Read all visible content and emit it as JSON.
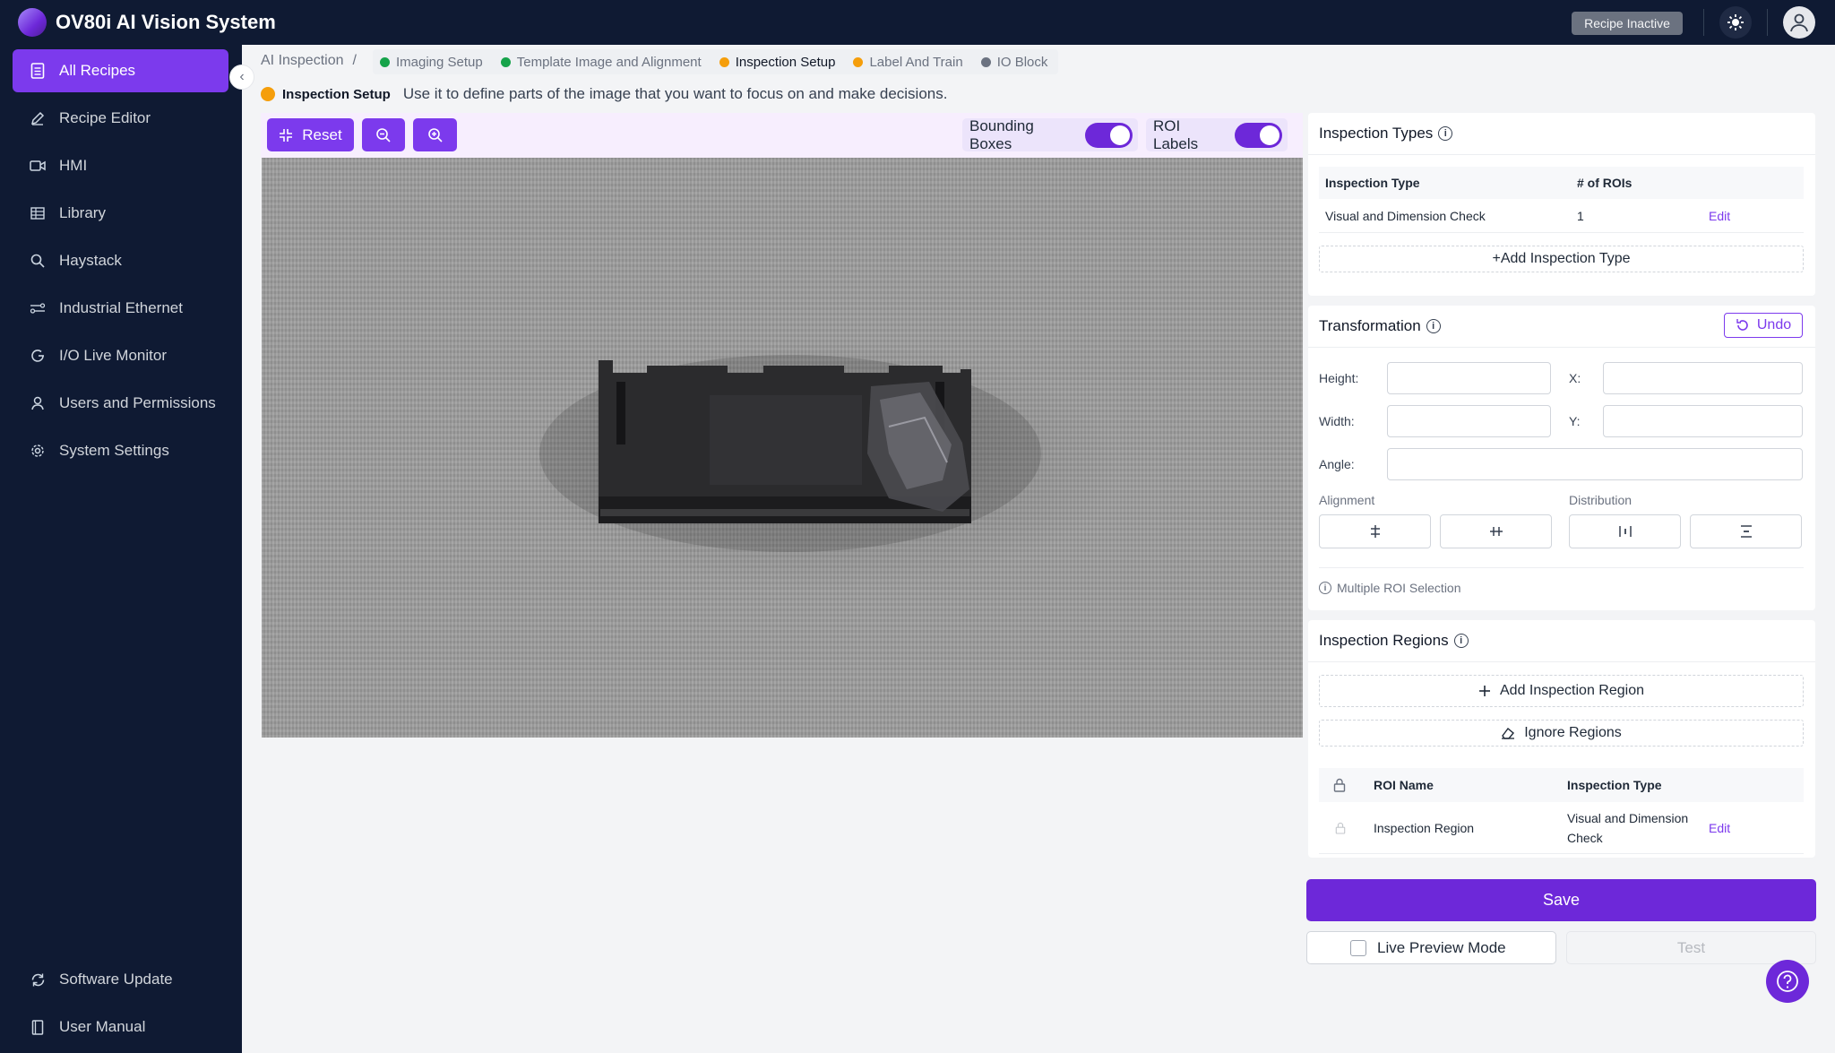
{
  "app": {
    "title": "OV80i AI Vision System",
    "recipe_status": "Recipe Inactive"
  },
  "sidebar": {
    "items": [
      {
        "label": "All Recipes",
        "icon": "document-icon",
        "active": true
      },
      {
        "label": "Recipe Editor",
        "icon": "pencil-icon"
      },
      {
        "label": "HMI",
        "icon": "video-icon"
      },
      {
        "label": "Library",
        "icon": "grid-icon"
      },
      {
        "label": "Haystack",
        "icon": "search-icon"
      },
      {
        "label": "Industrial Ethernet",
        "icon": "network-icon"
      },
      {
        "label": "I/O Live Monitor",
        "icon": "monitor-icon"
      },
      {
        "label": "Users and Permissions",
        "icon": "user-icon"
      },
      {
        "label": "System Settings",
        "icon": "gear-icon"
      }
    ],
    "bottom_items": [
      {
        "label": "Software Update",
        "icon": "refresh-icon"
      },
      {
        "label": "User Manual",
        "icon": "book-icon"
      }
    ]
  },
  "breadcrumb": {
    "root": "AI Inspection",
    "separator": "/"
  },
  "steps": [
    {
      "label": "Imaging Setup",
      "status_color": "#16a34a"
    },
    {
      "label": "Template Image and Alignment",
      "status_color": "#16a34a"
    },
    {
      "label": "Inspection Setup",
      "status_color": "#f59e0b",
      "current": true
    },
    {
      "label": "Label And Train",
      "status_color": "#f59e0b"
    },
    {
      "label": "IO Block",
      "status_color": "#6b7280"
    }
  ],
  "step_description": {
    "label": "Inspection Setup",
    "text": "Use it to define parts of the image that you want to focus on and make decisions."
  },
  "toolbar": {
    "reset_label": "Reset",
    "bounding_boxes_label": "Bounding Boxes",
    "bounding_boxes_on": true,
    "roi_labels_label": "ROI Labels",
    "roi_labels_on": true
  },
  "inspection_types": {
    "title": "Inspection Types",
    "columns": [
      "Inspection Type",
      "# of ROIs"
    ],
    "rows": [
      {
        "type": "Visual and Dimension Check",
        "count": "1",
        "action": "Edit"
      }
    ],
    "add_label": "+Add Inspection Type"
  },
  "transformation": {
    "title": "Transformation",
    "undo_label": "Undo",
    "fields": {
      "height": "Height:",
      "width": "Width:",
      "x": "X:",
      "y": "Y:",
      "angle": "Angle:"
    },
    "alignment_label": "Alignment",
    "distribution_label": "Distribution",
    "hint": "Multiple ROI Selection"
  },
  "inspection_regions": {
    "title": "Inspection Regions",
    "add_label": "Add Inspection Region",
    "ignore_label": "Ignore Regions",
    "columns": [
      "ROI Name",
      "Inspection Type"
    ],
    "rows": [
      {
        "name": "Inspection Region",
        "type_line1": "Visual and Dimension",
        "type_line2": "Check",
        "action": "Edit"
      }
    ]
  },
  "actions": {
    "save_label": "Save",
    "live_preview_label": "Live Preview Mode",
    "test_label": "Test"
  },
  "colors": {
    "accent": "#7c3aed",
    "nav_bg": "#0f1a33"
  }
}
